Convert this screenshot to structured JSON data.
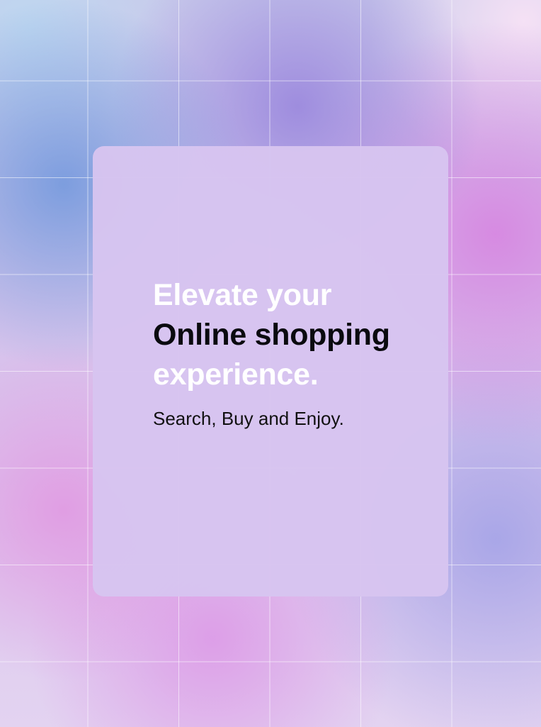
{
  "hero": {
    "headline_line1": "Elevate your",
    "headline_line2": "Online shopping",
    "headline_line3": "experience.",
    "tagline": "Search, Buy and Enjoy."
  },
  "colors": {
    "card_background": "#D7C4F0",
    "headline_light": "#FFFFFF",
    "headline_dark": "#0A0A0F",
    "tagline": "#111111"
  }
}
